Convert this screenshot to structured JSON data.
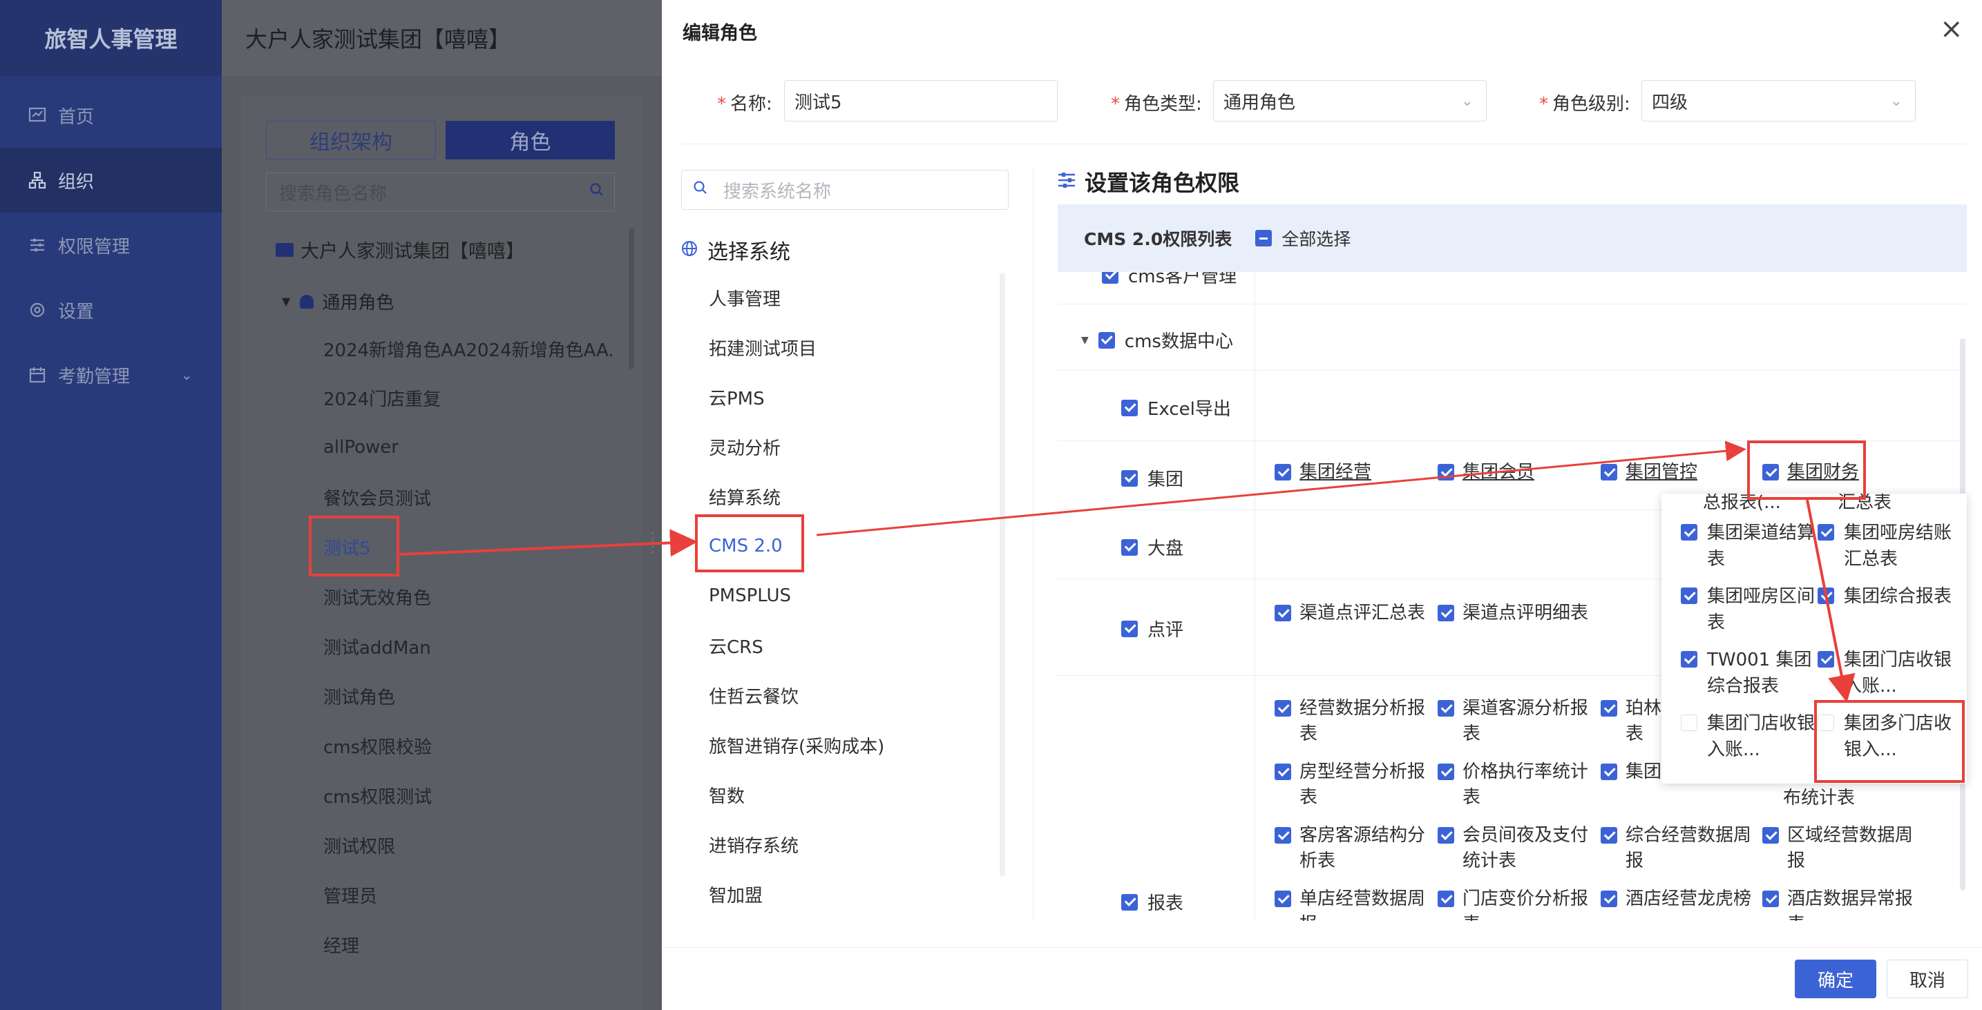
{
  "app": {
    "brand": "旅智人事管理"
  },
  "sidebar": {
    "items": [
      {
        "label": "首页",
        "icon": "chart-icon"
      },
      {
        "label": "组织",
        "icon": "org-icon",
        "active": true
      },
      {
        "label": "权限管理",
        "icon": "sliders-icon"
      },
      {
        "label": "设置",
        "icon": "settings-icon"
      },
      {
        "label": "考勤管理",
        "icon": "calendar-icon"
      }
    ]
  },
  "main": {
    "title": "大户人家测试集团【嘻嘻】",
    "tabs": [
      "组织架构",
      "角色"
    ],
    "search_placeholder": "搜索角色名称",
    "tree_root": "大户人家测试集团【嘻嘻】",
    "tree_group": "通用角色",
    "roles": [
      "2024新增角色AA2024新增角色AA...",
      "2024门店重复",
      "allPower",
      "餐饮会员测试",
      "测试5",
      "测试无效角色",
      "测试addMan",
      "测试角色",
      "cms权限校验",
      "cms权限测试",
      "测试权限",
      "管理员",
      "经理"
    ]
  },
  "modal": {
    "title": "编辑角色",
    "close": "×",
    "form": {
      "name_label": "名称:",
      "name_value": "测试5",
      "type_label": "角色类型:",
      "type_value": "通用角色",
      "level_label": "角色级别:",
      "level_value": "四级"
    },
    "systems": {
      "search_placeholder": "搜索系统名称",
      "title": "选择系统",
      "items": [
        "人事管理",
        "拓建测试项目",
        "云PMS",
        "灵动分析",
        "结算系统",
        "CMS 2.0",
        "PMSPLUS",
        "云CRS",
        "住哲云餐饮",
        "旅智进销存(采购成本)",
        "智数",
        "进销存系统",
        "智加盟"
      ],
      "active": "CMS 2.0"
    },
    "permissions": {
      "title": "设置该角色权限",
      "list_title": "CMS 2.0权限列表",
      "select_all": "全部选择",
      "partial_row": "cms客户管理",
      "data_center": "cms数据中心",
      "excel": "Excel导出",
      "group_label": "集团",
      "group_items": [
        "集团经营",
        "集团会员",
        "集团管控",
        "集团财务"
      ],
      "dashboard": "大盘",
      "review_label": "点评",
      "review_items": [
        "渠道点评汇总表",
        "渠道点评明细表"
      ],
      "report_label": "报表",
      "report_items": [
        "经营数据分析报表",
        "渠道客源分析报表",
        "珀林渠道数据报表",
        "",
        "房型经营分析报表",
        "价格执行率统计表",
        "集团渠道报表",
        "布统计表",
        "客房客源结构分析表",
        "会员间夜及支付统计表",
        "综合经营数据周报",
        "区域经营数据周报",
        "单店经营数据周报",
        "门店变价分析报表",
        "酒店经营龙虎榜",
        "酒店数据异常报表"
      ],
      "popover_top": "总报表(...",
      "popover_top_right": "汇总表",
      "popover_items": [
        {
          "label": "集团渠道结算表",
          "checked": true
        },
        {
          "label": "集团哑房结账汇总表",
          "checked": true
        },
        {
          "label": "集团哑房区间表",
          "checked": true
        },
        {
          "label": "集团综合报表",
          "checked": true
        },
        {
          "label": "TW001 集团综合报表",
          "checked": true
        },
        {
          "label": "集团门店收银入账...",
          "checked": true
        },
        {
          "label": "集团门店收银入账...",
          "checked": false
        },
        {
          "label": "集团多门店收银入...",
          "checked": false
        }
      ]
    },
    "footer": {
      "ok": "确定",
      "cancel": "取消"
    }
  },
  "colors": {
    "primary": "#3c63d6",
    "annotation": "#e8403a",
    "sidebar": "#293a7a"
  }
}
